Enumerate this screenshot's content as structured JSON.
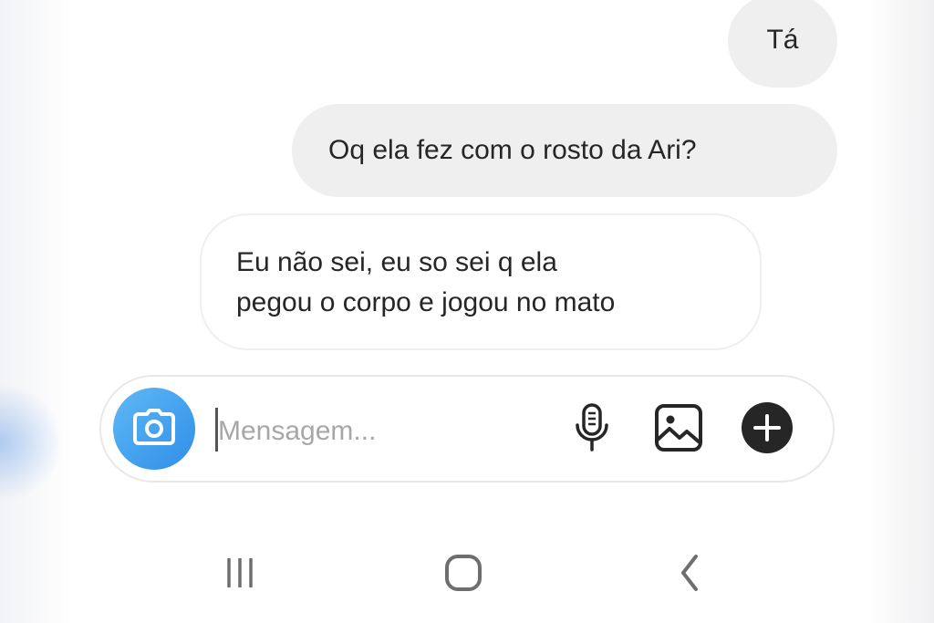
{
  "messages": [
    {
      "direction": "sent",
      "text": "Tá"
    },
    {
      "direction": "sent",
      "text": "Oq ela fez com o rosto da Ari?"
    },
    {
      "direction": "received",
      "lines": [
        "Eu não sei, eu so sei q ela",
        "pegou o corpo e jogou no mato"
      ]
    }
  ],
  "composer": {
    "placeholder": "Mensagem...",
    "value": "",
    "icons": {
      "camera": "camera-icon",
      "mic": "microphone-icon",
      "gallery": "image-gallery-icon",
      "more": "plus-circle-icon"
    },
    "camera_color": "#3797f0"
  },
  "navbar": {
    "icons": [
      "recent-apps-icon",
      "home-icon",
      "back-icon"
    ]
  }
}
